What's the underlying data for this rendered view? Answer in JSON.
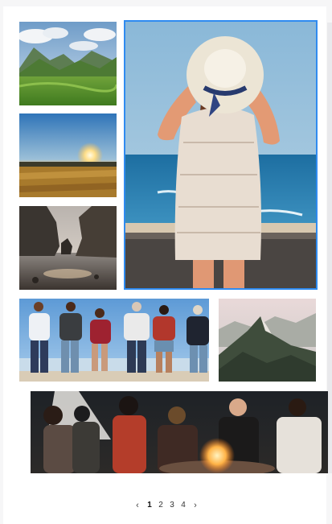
{
  "gallery": {
    "images": [
      {
        "label": "mountain-meadow",
        "selected": false
      },
      {
        "label": "sunset-field",
        "selected": false
      },
      {
        "label": "sea-cliffs",
        "selected": false
      },
      {
        "label": "woman-straw-hat-ocean",
        "selected": true
      },
      {
        "label": "friends-on-beach",
        "selected": false
      },
      {
        "label": "mountain-ridge",
        "selected": false
      },
      {
        "label": "campfire-group",
        "selected": false
      }
    ]
  },
  "pagination": {
    "prev_icon": "chevron-left-icon",
    "next_icon": "chevron-right-icon",
    "pages": [
      "1",
      "2",
      "3",
      "4"
    ],
    "current_page": "1"
  },
  "colors": {
    "selection_outline": "#2f8bf0",
    "panel_background": "#ffffff"
  }
}
